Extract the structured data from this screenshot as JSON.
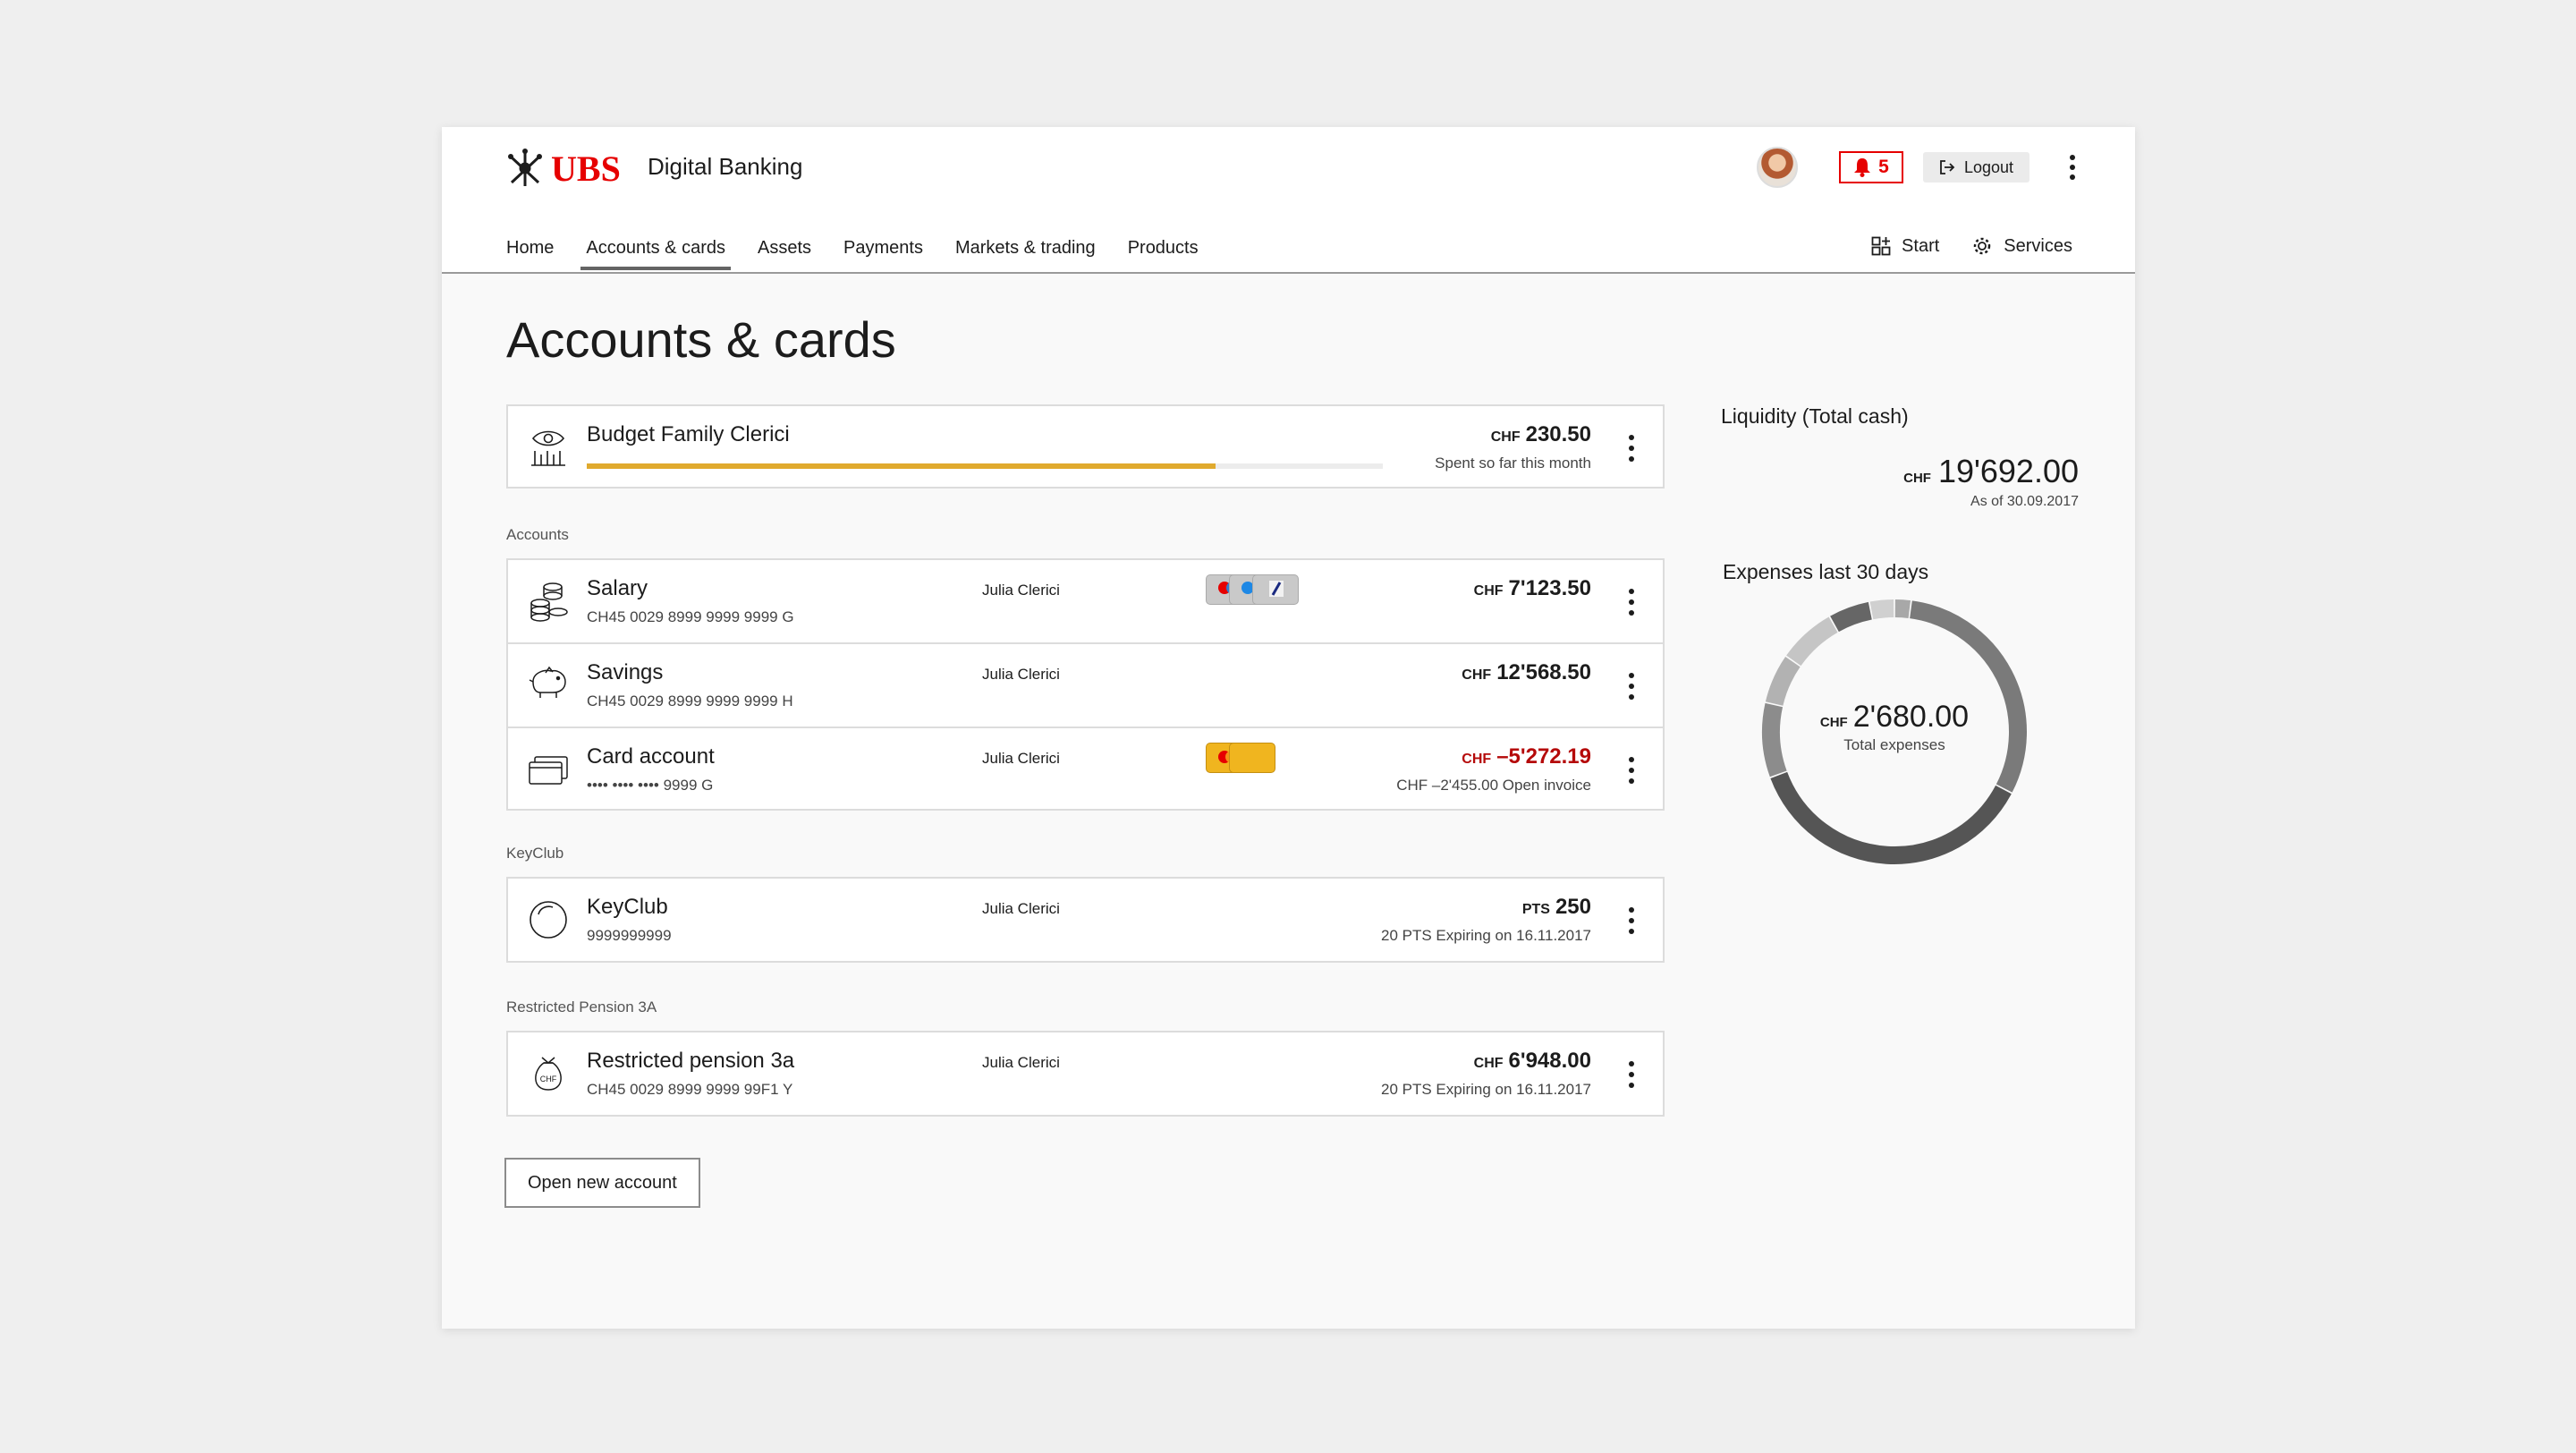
{
  "brand": {
    "logo_text": "UBS",
    "product": "Digital Banking",
    "accent": "#e60000"
  },
  "header": {
    "notifications": "5",
    "logout_label": "Logout"
  },
  "nav": {
    "items": [
      {
        "label": "Home"
      },
      {
        "label": "Accounts & cards",
        "active": true
      },
      {
        "label": "Assets"
      },
      {
        "label": "Payments"
      },
      {
        "label": "Markets & trading"
      },
      {
        "label": "Products"
      }
    ],
    "start_label": "Start",
    "services_label": "Services"
  },
  "page": {
    "title": "Accounts & cards"
  },
  "budget": {
    "name": "Budget Family Clerici",
    "currency": "CHF",
    "amount": "230.50",
    "note": "Spent so far this month",
    "progress": 0.79
  },
  "sections": {
    "accounts": "Accounts",
    "keyclub": "KeyClub",
    "pension": "Restricted Pension 3A"
  },
  "accounts": [
    {
      "name": "Salary",
      "sub": "CH45 0029 8999 9999 9999 G",
      "owner": "Julia Clerici",
      "currency": "CHF",
      "amount": "7'123.50",
      "note": ""
    },
    {
      "name": "Savings",
      "sub": "CH45 0029 8999 9999 9999 H",
      "owner": "Julia Clerici",
      "currency": "CHF",
      "amount": "12'568.50",
      "note": ""
    },
    {
      "name": "Card account",
      "sub": "•••• •••• •••• 9999 G",
      "owner": "Julia Clerici",
      "currency": "CHF",
      "amount": "–5'272.19",
      "note": "CHF –2'455.00 Open invoice"
    }
  ],
  "keyclub": {
    "name": "KeyClub",
    "sub": "9999999999",
    "owner": "Julia Clerici",
    "currency": "PTS",
    "amount": "250",
    "note": "20 PTS Expiring on 16.11.2017"
  },
  "pension": {
    "name": "Restricted pension 3a",
    "sub": "CH45 0029 8999 9999 99F1 Y",
    "owner": "Julia Clerici",
    "currency": "CHF",
    "amount": "6'948.00",
    "note": "20 PTS Expiring on 16.11.2017"
  },
  "open_account_label": "Open new account",
  "liquidity": {
    "title": "Liquidity (Total cash)",
    "currency": "CHF",
    "amount": "19'692.00",
    "date": "As of 30.09.2017"
  },
  "expenses": {
    "title": "Expenses last 30 days",
    "currency": "CHF",
    "amount": "2'680.00",
    "label": "Total expenses",
    "segments": [
      {
        "value": 0.02,
        "color": "#a8a8a8"
      },
      {
        "value": 0.3,
        "color": "#7a7a7a"
      },
      {
        "value": 0.36,
        "color": "#555555"
      },
      {
        "value": 0.09,
        "color": "#8c8c8c"
      },
      {
        "value": 0.06,
        "color": "#b2b2b2"
      },
      {
        "value": 0.07,
        "color": "#c5c5c5"
      },
      {
        "value": 0.05,
        "color": "#666666"
      },
      {
        "value": 0.03,
        "color": "#d0d0d0"
      }
    ]
  }
}
